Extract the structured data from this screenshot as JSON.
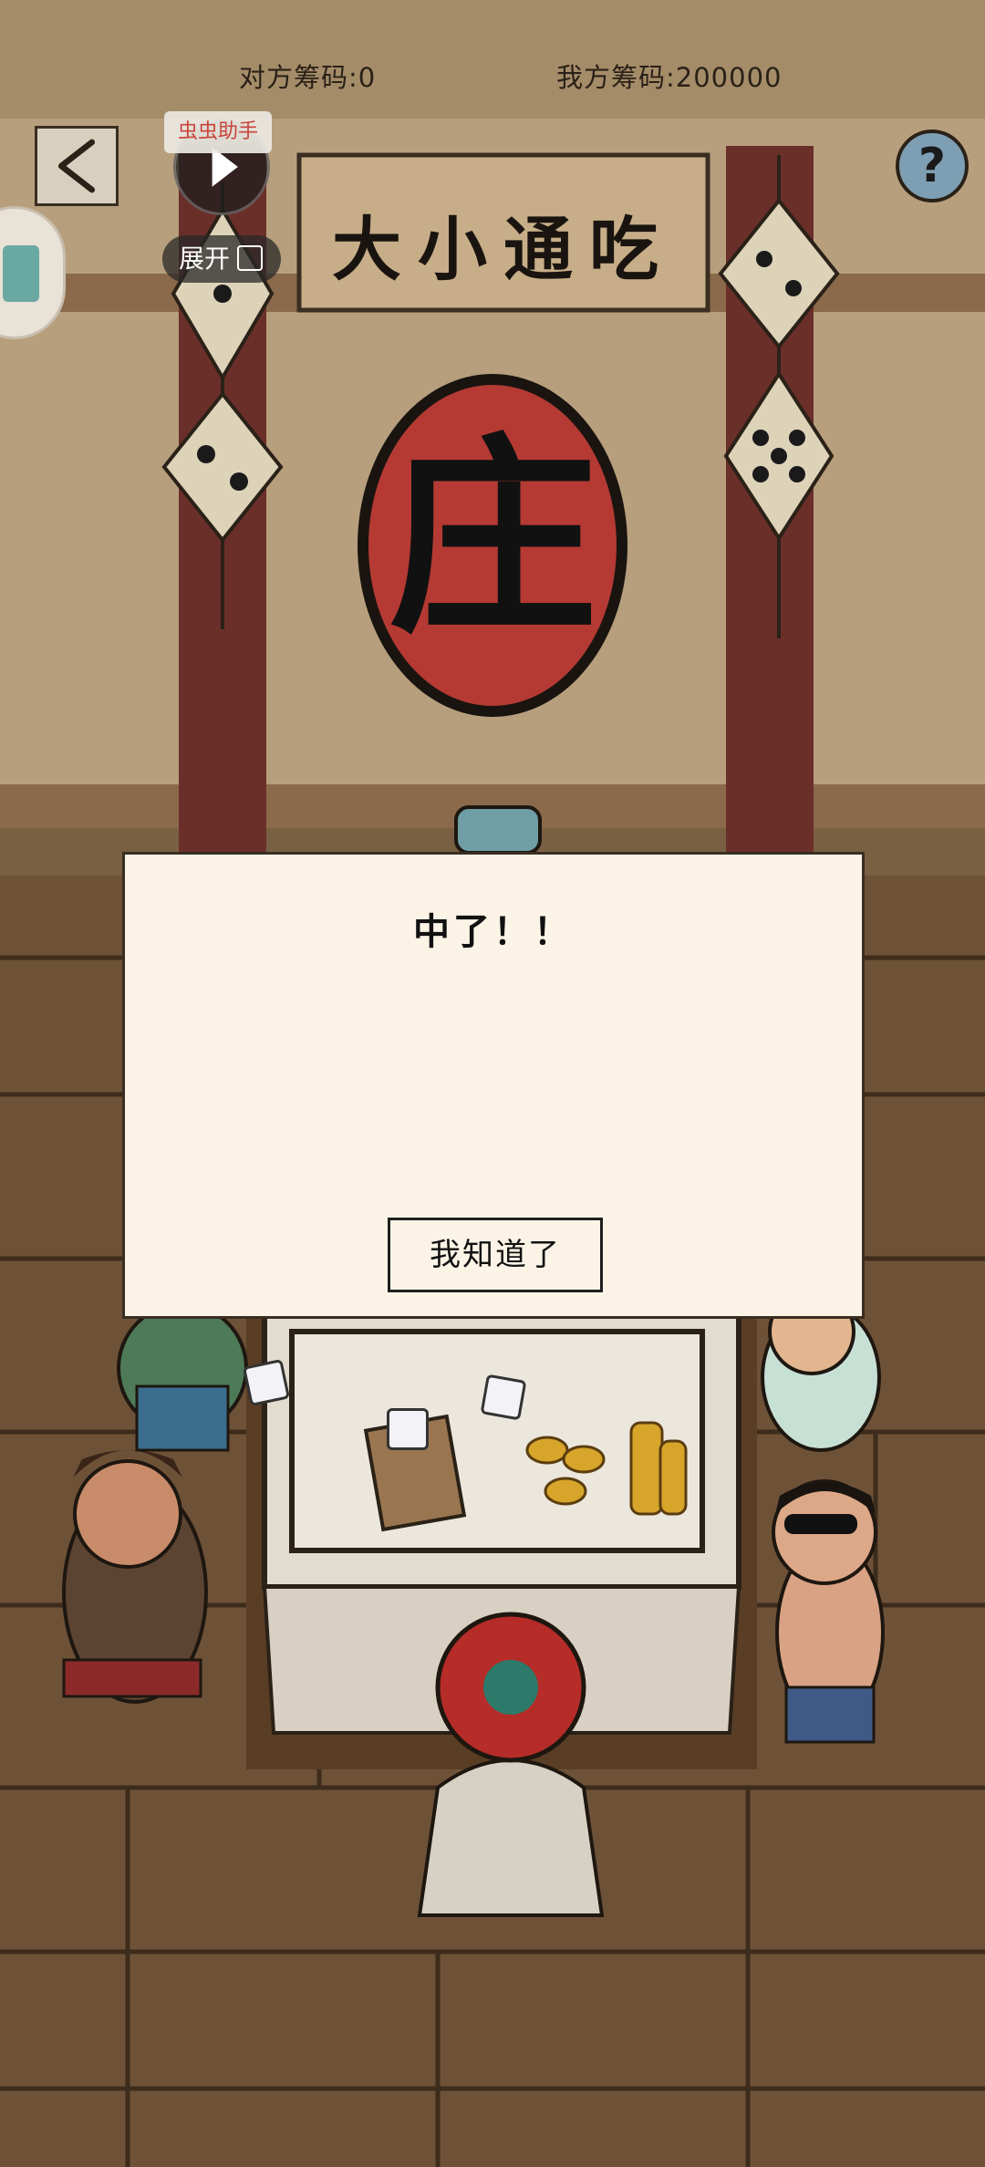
{
  "hud": {
    "opponent_chips": "对方筹码:0",
    "my_chips": "我方筹码:200000"
  },
  "helper": {
    "tag": "虫虫助手",
    "expand_label": "展开"
  },
  "help_button": "?",
  "sign": {
    "banner": "大小通吃",
    "dealer_char": "庄"
  },
  "dialog": {
    "message": "中了！！",
    "confirm_label": "我知道了"
  },
  "colors": {
    "wall": "#b79f7d",
    "pillar": "#6b2f2a",
    "dealer_circle": "#b43a33",
    "dialog_bg": "#fbf4e6",
    "floor": "#6e5238"
  },
  "icons": [
    "back-arrow-icon",
    "play-icon",
    "expand-icon",
    "help-icon",
    "dice-icon"
  ]
}
